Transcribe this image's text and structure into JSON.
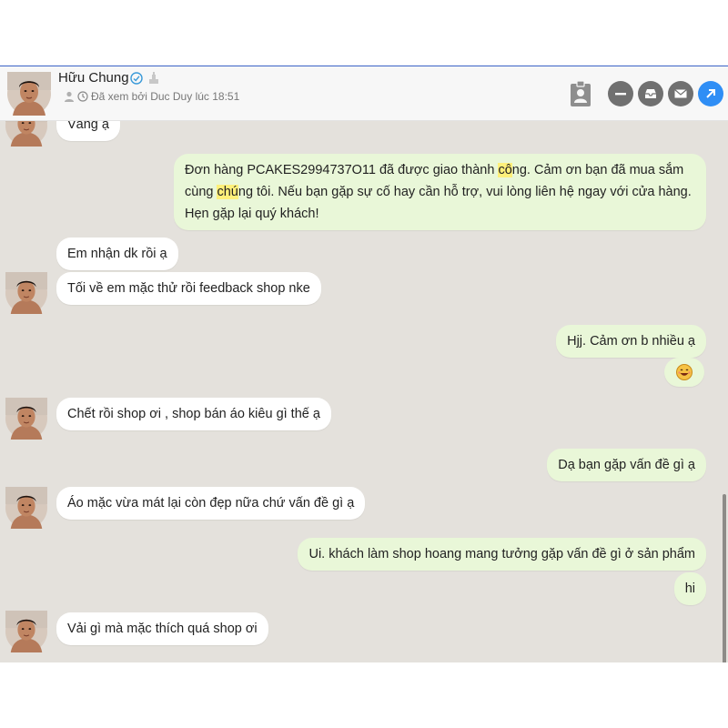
{
  "header": {
    "name": "Hữu Chung",
    "seen_text": "Đã xem bởi Duc Duy lúc 18:51"
  },
  "messages": [
    {
      "from": "customer",
      "text": "Vâng ạ"
    },
    {
      "from": "shop",
      "text": "Đơn hàng PCAKES2994737O11 đã được giao thành công. Cảm ơn bạn đã mua sắm cùng chúng tôi. Nếu bạn gặp sự cố hay cần hỗ trợ, vui lòng liên hệ ngay với cửa hàng. Hẹn gặp lại quý khách!",
      "parts": [
        "Đơn hàng PCAKES2994737O11 đã được giao thành ",
        "cô",
        "ng. Cảm ơn bạn đã mua sắm cùng ",
        "chú",
        "ng tôi. Nếu bạn gặp sự cố hay cần hỗ trợ, vui lòng liên hệ ngay với cửa hàng. Hẹn gặp lại quý khách!"
      ]
    },
    {
      "from": "customer",
      "text": "Em nhận dk rồi ạ"
    },
    {
      "from": "customer",
      "text": "Tối về em mặc thử rồi feedback shop nke"
    },
    {
      "from": "shop",
      "text": "Hjj. Cảm ơn b nhiều ạ"
    },
    {
      "from": "shop",
      "emoji": "smiling-face-emoji"
    },
    {
      "from": "customer",
      "text": "Chết rồi shop ơi , shop bán áo kiêu gì thế ạ"
    },
    {
      "from": "shop",
      "text": "Dạ bạn gặp vấn đề gì ạ"
    },
    {
      "from": "customer",
      "text": "Áo mặc vừa mát lại còn đẹp nữa chứ vấn đề gì ạ"
    },
    {
      "from": "shop",
      "text": "Ui. khách làm shop hoang mang tưởng gặp vấn đề gì ở sản phẩm"
    },
    {
      "from": "shop",
      "text": "hi"
    },
    {
      "from": "customer",
      "text": "Vải gì mà mặc thích quá shop ơi"
    }
  ],
  "icons": {
    "verified": "verified-badge-icon",
    "hat": "graduation-icon",
    "user": "user-icon",
    "clock": "clock-icon",
    "contact_card": "contact-card-icon",
    "minimize": "minimize-icon",
    "inbox": "inbox-icon",
    "mail": "mail-icon",
    "popout": "popout-icon"
  },
  "colors": {
    "chat_bg": "#e4e1dc",
    "bubble_in": "#ffffff",
    "bubble_out": "#e9f7d8",
    "highlight": "#fff07a",
    "accent_blue": "#2f8ef5",
    "button_gray": "#707070"
  }
}
